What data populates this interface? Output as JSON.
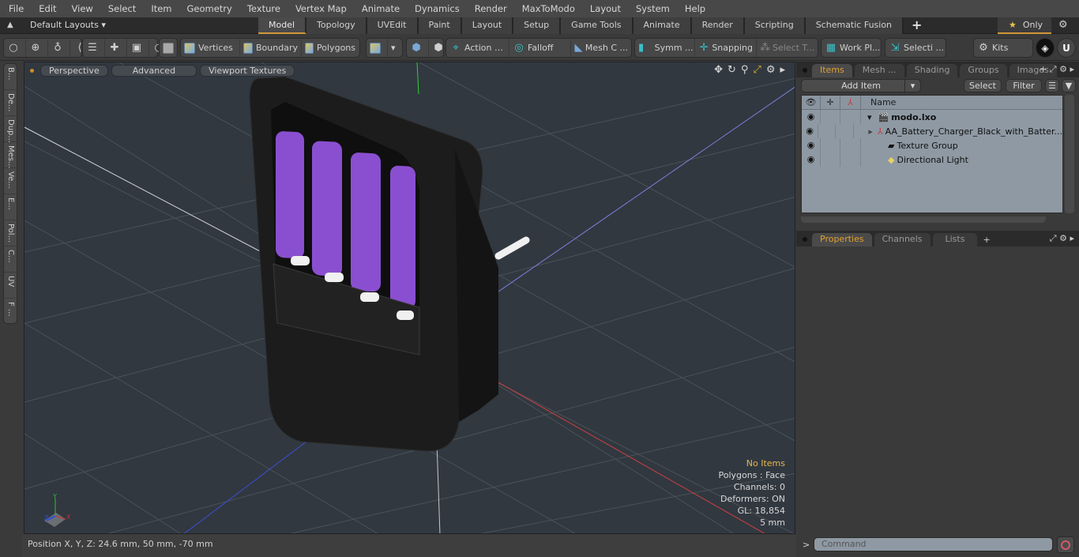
{
  "menu": [
    "File",
    "Edit",
    "View",
    "Select",
    "Item",
    "Geometry",
    "Texture",
    "Vertex Map",
    "Animate",
    "Dynamics",
    "Render",
    "MaxToModo",
    "Layout",
    "System",
    "Help"
  ],
  "layoutbar": {
    "layout_selector": "Default Layouts",
    "tabs": [
      "Model",
      "Topology",
      "UVEdit",
      "Paint",
      "Layout",
      "Setup",
      "Game Tools",
      "Animate",
      "Render",
      "Scripting",
      "Schematic Fusion"
    ],
    "active_tab": "Model",
    "only_label": "Only"
  },
  "toolbar": {
    "vertices": "Vertices",
    "boundary": "Boundary",
    "polygons": "Polygons",
    "action": "Action",
    "falloff": "Falloff",
    "mesh": "Mesh C ...",
    "symm": "Symm ...",
    "snapping": "Snapping",
    "select_t": "Select T...",
    "workplane": "Work Pl...",
    "selection": "Selecti ...",
    "kits": "Kits"
  },
  "left_tabs": [
    "B...",
    "De...",
    "Dup...",
    "Mes...",
    "Ve...",
    "E...",
    "Pol...",
    "C...",
    "UV",
    "F ..."
  ],
  "viewport": {
    "view_mode": "Perspective",
    "shading": "Advanced",
    "textures": "Viewport Textures",
    "stats": {
      "selection": "No Items",
      "polygons": "Polygons : Face",
      "channels": "Channels: 0",
      "deformers": "Deformers: ON",
      "gl": "GL: 18,854",
      "grid": "5 mm"
    }
  },
  "status": {
    "position": "Position X, Y, Z:   24.6 mm, 50 mm, -70 mm"
  },
  "items_panel": {
    "tabs": [
      "Items",
      "Mesh ...",
      "Shading",
      "Groups",
      "Images"
    ],
    "active_tab": "Items",
    "add_item": "Add Item",
    "select": "Select",
    "filter": "Filter",
    "column_name": "Name",
    "tree": [
      {
        "name": "modo.lxo",
        "level": 0,
        "icon": "scene-icon",
        "expanded": true
      },
      {
        "name": "AA_Battery_Charger_Black_with_Batter...",
        "level": 1,
        "icon": "mesh-locator-icon",
        "expanded": false
      },
      {
        "name": "Texture Group",
        "level": 1,
        "icon": "folder-icon"
      },
      {
        "name": "Directional Light",
        "level": 1,
        "icon": "light-icon"
      }
    ]
  },
  "properties_panel": {
    "tabs": [
      "Properties",
      "Channels",
      "Lists"
    ],
    "active_tab": "Properties"
  },
  "command": {
    "placeholder": "Command"
  },
  "colors": {
    "accent": "#d19637",
    "active_tab_text": "#e0a030",
    "battery": "#8a4fd0",
    "stats_highlight": "#e8b84a"
  }
}
